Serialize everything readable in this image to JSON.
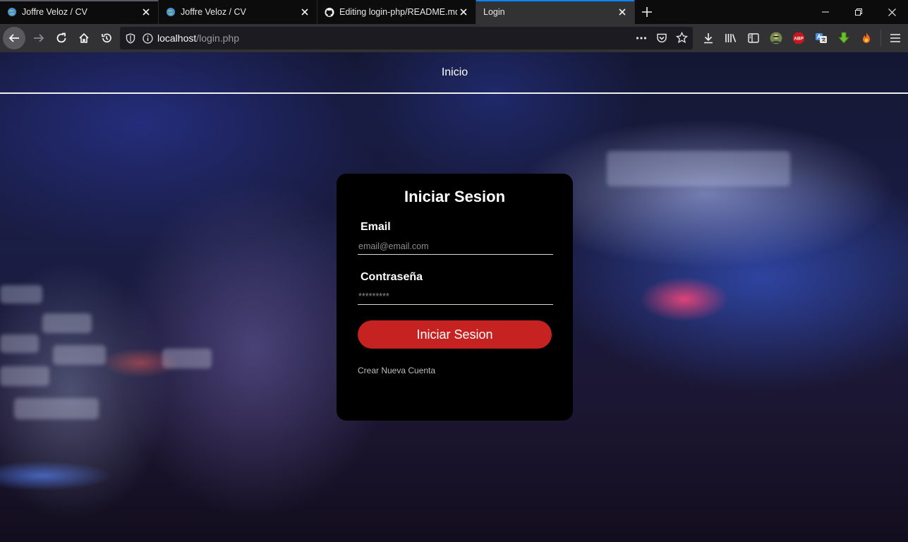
{
  "browser": {
    "tabs": [
      {
        "title": "Joffre Veloz / CV",
        "active": false
      },
      {
        "title": "Joffre Veloz / CV",
        "active": false
      },
      {
        "title": "Editing login-php/README.md",
        "active": false
      },
      {
        "title": "Login",
        "active": true
      }
    ],
    "url": {
      "host": "localhost",
      "path": "/login.php"
    },
    "ublock_badge": "ABP"
  },
  "page": {
    "nav_link": "Inicio",
    "login": {
      "title": "Iniciar Sesion",
      "email_label": "Email",
      "email_placeholder": "email@email.com",
      "password_label": "Contraseña",
      "password_placeholder": "*********",
      "submit_label": "Iniciar Sesion",
      "create_account_link": "Crear Nueva Cuenta"
    }
  },
  "colors": {
    "accent_button": "#c62222",
    "card_background": "#000000",
    "tab_active_indicator": "#0a84ff"
  },
  "icons": [
    "back-icon",
    "forward-icon",
    "reload-icon",
    "home-icon",
    "history-icon",
    "shield-icon",
    "info-icon",
    "more-icon",
    "pocket-icon",
    "star-icon",
    "download-icon",
    "library-icon",
    "sidebar-icon",
    "avatar-icon",
    "adblock-icon",
    "translate-icon",
    "green-arrow-icon",
    "fire-icon",
    "menu-icon"
  ]
}
